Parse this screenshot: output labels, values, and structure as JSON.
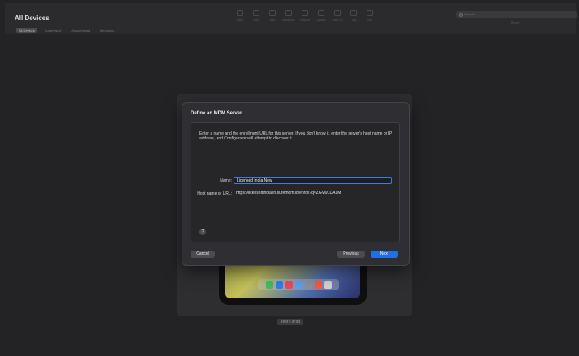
{
  "window": {
    "title": "All Devices",
    "filters": [
      {
        "label": "All Devices",
        "active": true
      },
      {
        "label": "Supervised",
        "active": false
      },
      {
        "label": "Unsupervised",
        "active": false
      },
      {
        "label": "Recovery",
        "active": false
      }
    ]
  },
  "toolbar": {
    "items": [
      {
        "label": "Back",
        "icon": "back-icon"
      },
      {
        "label": "View",
        "icon": "view-icon"
      },
      {
        "label": "Add",
        "icon": "add-icon"
      },
      {
        "label": "Blueprints",
        "icon": "blueprints-icon"
      },
      {
        "label": "Prepare",
        "icon": "prepare-icon"
      },
      {
        "label": "Update",
        "icon": "update-icon"
      },
      {
        "label": "Back Up",
        "icon": "backup-icon"
      },
      {
        "label": "Tag",
        "icon": "tag-icon"
      },
      {
        "label": "Info",
        "icon": "info-icon"
      }
    ],
    "search_placeholder": "Search",
    "report_label": "Report"
  },
  "device": {
    "name": "Test's iPad"
  },
  "dialog": {
    "title": "Define an MDM Server",
    "description": "Enter a name and the enrollment URL for this server. If you don't know it, enter the server's host name or IP address, and Configurator will attempt to discover it.",
    "name_label": "Name:",
    "name_value": "Licensed India New",
    "url_label": "Host name or URL:",
    "url_value": "https://licensedindia.in.suremdm.io/enroll?q=ZGVwLDA1M",
    "help_label": "?",
    "cancel_label": "Cancel",
    "previous_label": "Previous",
    "next_label": "Next"
  },
  "colors": {
    "accent": "#1f6fe5",
    "background": "#232325",
    "dialog": "#2f2f33"
  }
}
